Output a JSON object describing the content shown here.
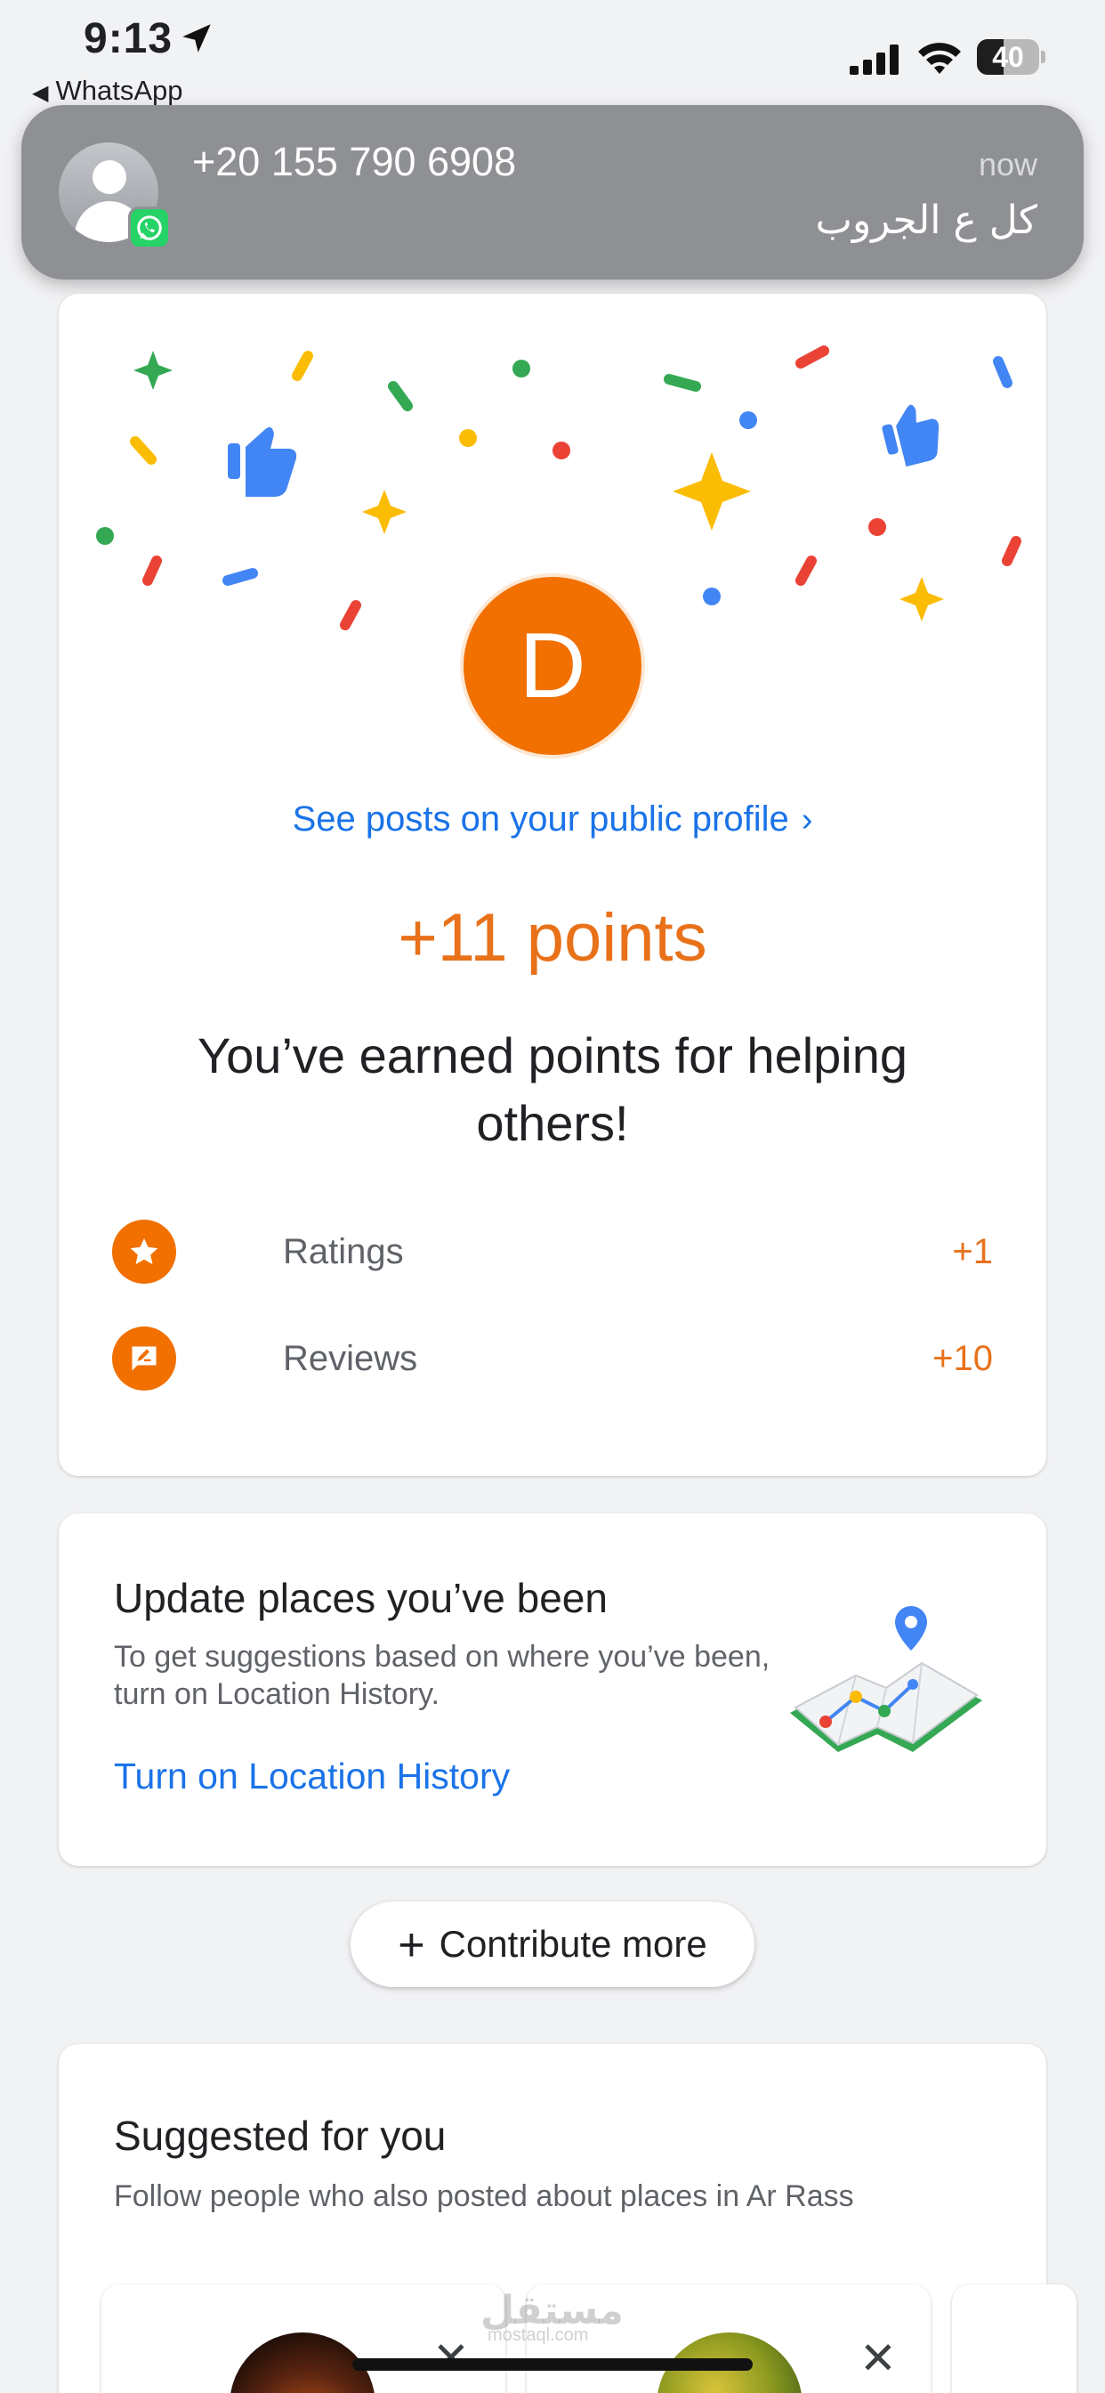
{
  "status_bar": {
    "time": "9:13",
    "back_app": "WhatsApp",
    "battery_level": "40"
  },
  "notification": {
    "sender": "+20 155 790 6908",
    "time": "now",
    "message": "كل ع الجروب",
    "app_icon": "whatsapp-icon"
  },
  "points_card": {
    "avatar_letter": "D",
    "public_profile_link": "See posts on your public profile",
    "points": "+11 points",
    "headline": "You’ve earned points for helping others!",
    "rows": [
      {
        "label": "Ratings",
        "value": "+1",
        "icon": "star-icon"
      },
      {
        "label": "Reviews",
        "value": "+10",
        "icon": "review-icon"
      }
    ]
  },
  "update_card": {
    "title": "Update places you’ve been",
    "description": "To get suggestions based on where you’ve been, turn on Location History.",
    "link": "Turn on Location History"
  },
  "contribute_button": "Contribute more",
  "suggested": {
    "title": "Suggested for you",
    "subtitle": "Follow people who also posted about places in Ar Rass"
  },
  "watermark": {
    "text": "مستقل",
    "sub": "mostaql.com"
  },
  "colors": {
    "accent_orange": "#f17000",
    "link_blue": "#1a73e8",
    "notification_bg": "#8e9093"
  }
}
